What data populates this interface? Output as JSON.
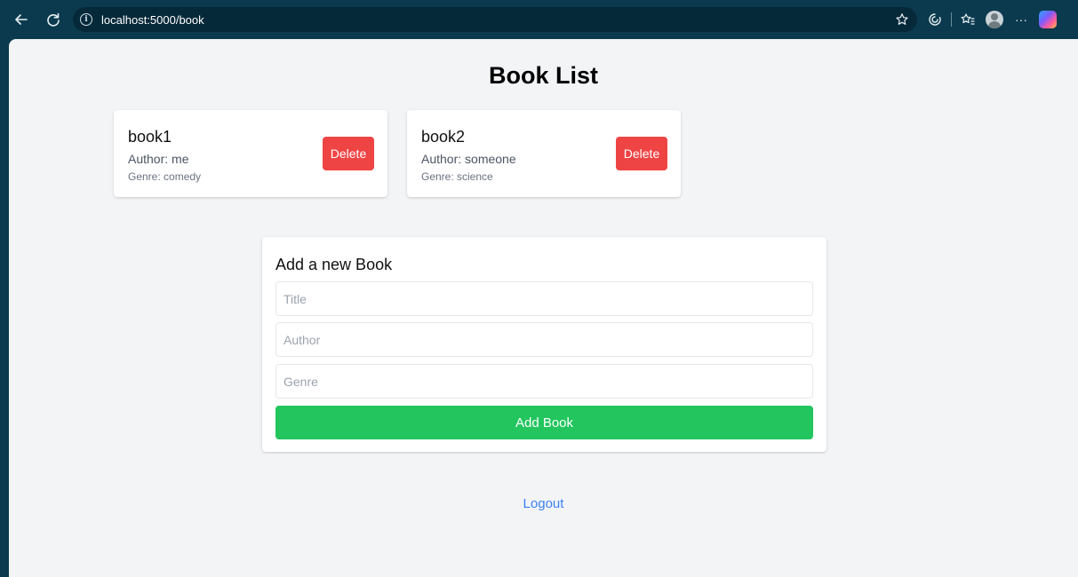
{
  "browser": {
    "url": "localhost:5000/book",
    "icons": [
      "back-arrow-icon",
      "refresh-icon",
      "info-icon",
      "star-icon",
      "browser-essentials-icon",
      "favorites-icon",
      "profile-avatar",
      "more-icon",
      "copilot-icon"
    ],
    "more_label": "···"
  },
  "page": {
    "title": "Book List"
  },
  "books": [
    {
      "title": "book1",
      "author": "Author: me",
      "genre": "Genre: comedy",
      "delete_label": "Delete"
    },
    {
      "title": "book2",
      "author": "Author: someone",
      "genre": "Genre: science",
      "delete_label": "Delete"
    }
  ],
  "form": {
    "title": "Add a new Book",
    "title_placeholder": "Title",
    "author_placeholder": "Author",
    "genre_placeholder": "Genre",
    "submit_label": "Add Book"
  },
  "logout_label": "Logout",
  "colors": {
    "chrome": "#0b3a4e",
    "background": "#f3f4f6",
    "delete": "#ef4444",
    "add": "#22c55e",
    "link": "#3b82f6"
  }
}
